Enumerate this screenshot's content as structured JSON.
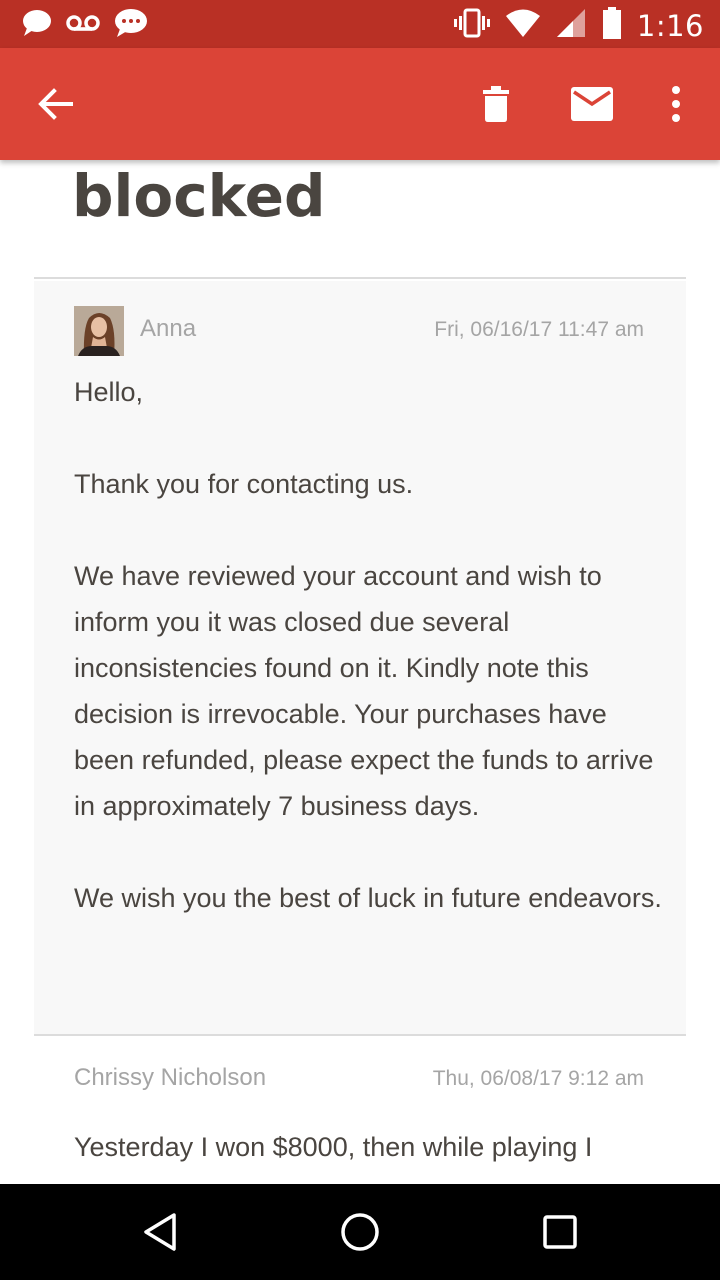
{
  "status_bar": {
    "time": "1:16",
    "icons": [
      "chat-bubble-icon",
      "voicemail-icon",
      "chat-bubble-icon",
      "vibrate-icon",
      "wifi-icon",
      "signal-icon",
      "battery-icon"
    ]
  },
  "app_bar": {
    "background": "#db4437",
    "actions": [
      "back-arrow-icon",
      "delete-icon",
      "mail-icon",
      "more-vert-icon"
    ]
  },
  "email": {
    "subject": "blocked",
    "messages": [
      {
        "sender": "Anna",
        "date": "Fri, 06/16/17 11:47 am",
        "paragraphs": [
          "Hello,",
          "Thank you for contacting us.",
          "We have reviewed your account and wish to inform you it was closed due several inconsistencies found on it. Kindly note this decision is irrevocable. Your purchases have been refunded, please expect the funds to arrive in approximately 7 business days.",
          "We wish you the best of luck in future endeavors."
        ]
      },
      {
        "sender": "Chrissy Nicholson",
        "date": "Thu, 06/08/17 9:12 am",
        "paragraphs": [
          "Yesterday I won $8000, then while playing I"
        ]
      }
    ]
  },
  "nav_bar": {
    "buttons": [
      "back-triangle-icon",
      "home-circle-icon",
      "recents-square-icon"
    ]
  }
}
